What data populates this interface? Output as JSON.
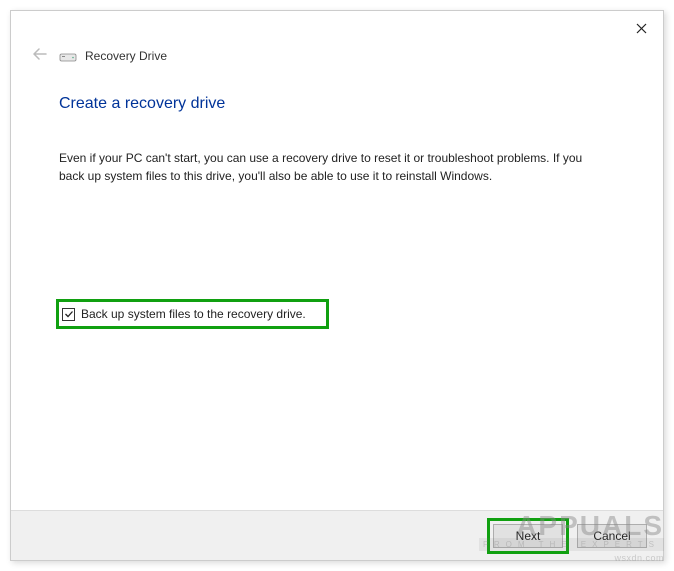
{
  "header": {
    "title": "Recovery Drive"
  },
  "main": {
    "heading": "Create a recovery drive",
    "body": "Even if your PC can't start, you can use a recovery drive to reset it or troubleshoot problems. If you back up system files to this drive, you'll also be able to use it to reinstall Windows."
  },
  "checkbox": {
    "label": "Back up system files to the recovery drive.",
    "checked": true
  },
  "buttons": {
    "next": "Next",
    "cancel": "Cancel"
  },
  "watermark": {
    "brand": "APPUALS",
    "tagline": "FROM THE EXPERTS",
    "url": "wsxdn.com"
  }
}
